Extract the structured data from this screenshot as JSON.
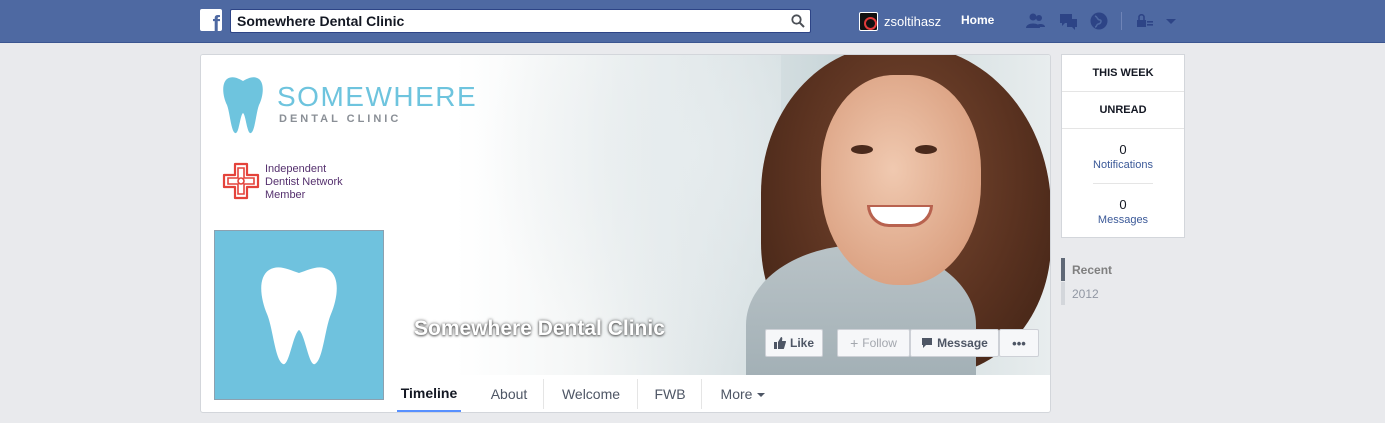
{
  "topbar": {
    "search_value": "Somewhere Dental Clinic",
    "user_name": "zsoltihasz",
    "home_label": "Home"
  },
  "page": {
    "brand_name": "SOMEWHERE",
    "brand_sub": "DENTAL CLINIC",
    "network_lines": [
      "Independent",
      "Dentist Network",
      "Member"
    ],
    "page_name": "Somewhere Dental Clinic"
  },
  "actions": {
    "like": "Like",
    "follow": "Follow",
    "message": "Message",
    "more": "•••"
  },
  "tabs": [
    {
      "label": "Timeline"
    },
    {
      "label": "About"
    },
    {
      "label": "Welcome"
    },
    {
      "label": "FWB"
    },
    {
      "label": "More"
    }
  ],
  "sidebar": {
    "this_week": "THIS WEEK",
    "unread": "UNREAD",
    "notifications_count": "0",
    "notifications_label": "Notifications",
    "messages_count": "0",
    "messages_label": "Messages",
    "timeline": [
      {
        "label": "Recent"
      },
      {
        "label": "2012"
      }
    ]
  },
  "colors": {
    "topbar": "#4e69a2",
    "brand_blue": "#6ec4de",
    "tab_underline": "#5890ff",
    "link": "#3b5998"
  }
}
